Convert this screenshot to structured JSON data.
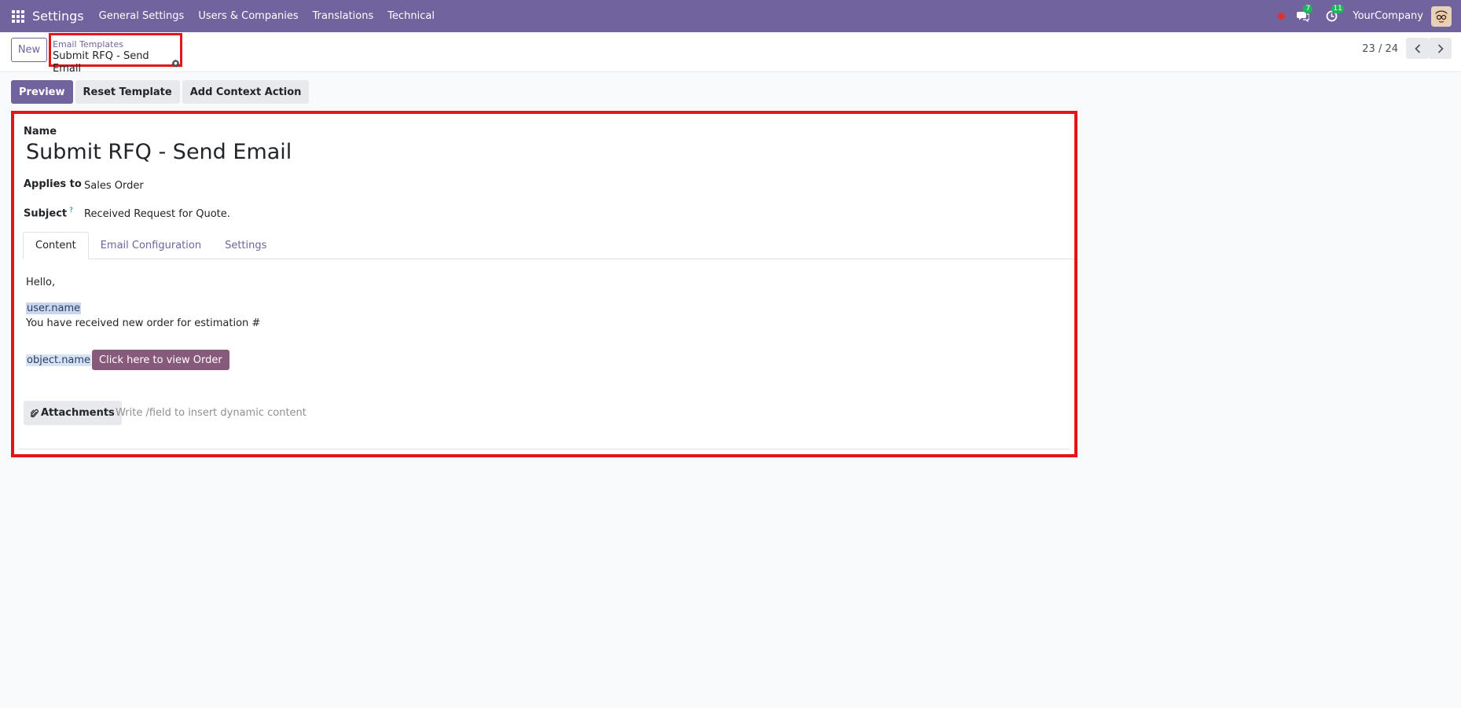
{
  "navbar": {
    "app_name": "Settings",
    "menu": [
      "General Settings",
      "Users & Companies",
      "Translations",
      "Technical"
    ],
    "messages_count": "7",
    "activities_count": "11",
    "company": "YourCompany"
  },
  "control_panel": {
    "new_label": "New",
    "breadcrumb_parent": "Email Templates",
    "breadcrumb_current": "Submit RFQ - Send Email",
    "pager": "23 / 24"
  },
  "actions": {
    "preview": "Preview",
    "reset": "Reset Template",
    "context": "Add Context Action"
  },
  "form": {
    "name_label": "Name",
    "name_value": "Submit RFQ - Send Email",
    "applies_to_label": "Applies to",
    "applies_to_value": "Sales Order",
    "subject_label": "Subject",
    "subject_help": "?",
    "subject_value": "Received Request for Quote.",
    "tabs": [
      "Content",
      "Email Configuration",
      "Settings"
    ],
    "body": {
      "greeting": "Hello,",
      "user_placeholder": "user.name",
      "line": "You have received new order for estimation #",
      "object_placeholder": "object.name",
      "order_button": "Click here to view Order"
    },
    "attachments_label": "Attachments",
    "dynamic_placeholder": "Write /field to insert dynamic content"
  },
  "colors": {
    "brand": "#71639e",
    "highlight_border": "#e5141b",
    "order_button": "#875a7b",
    "badge": "#21b55a"
  }
}
